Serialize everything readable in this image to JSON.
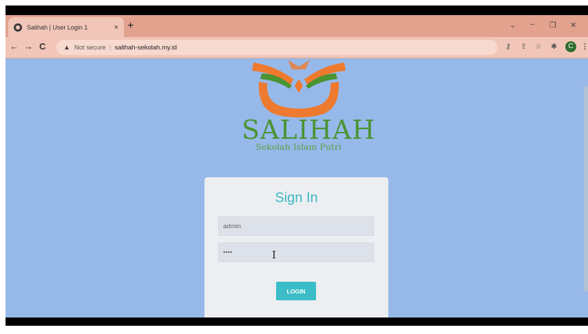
{
  "browser": {
    "tab": {
      "title": "Salihah | User Login 1",
      "close": "×"
    },
    "new_tab": "+",
    "window_controls": {
      "collapse": "⌄",
      "minimize": "−",
      "restore": "❐",
      "close": "✕"
    },
    "nav": {
      "back": "←",
      "forward": "→",
      "reload": "C"
    },
    "address": {
      "security_icon": "warning-triangle-icon",
      "warning_glyph": "▲",
      "security_label": "Not secure",
      "separator": "|",
      "url": "salihah-sekolah.my.id"
    },
    "toolbar": {
      "key_glyph": "⚷",
      "share_glyph": "⇪",
      "star_glyph": "☆",
      "extensions_glyph": "✱",
      "profile_initial": "C",
      "menu_glyph": "⋮"
    }
  },
  "page": {
    "logo_alt": "Salihah logo",
    "brand_name": "SALIHAH",
    "tagline": "Sekolah Islam Putri",
    "form": {
      "heading": "Sign In",
      "username_value": "admin",
      "password_value": "••••",
      "button_label": "LOGIN"
    },
    "cursor_glyph": "I"
  },
  "colors": {
    "page_background": "#96b9ea",
    "brand_green": "#4a9432",
    "accent_teal": "#3bbcc8",
    "logo_orange": "#ee7a2f",
    "tab_strip": "#e3a28e"
  }
}
